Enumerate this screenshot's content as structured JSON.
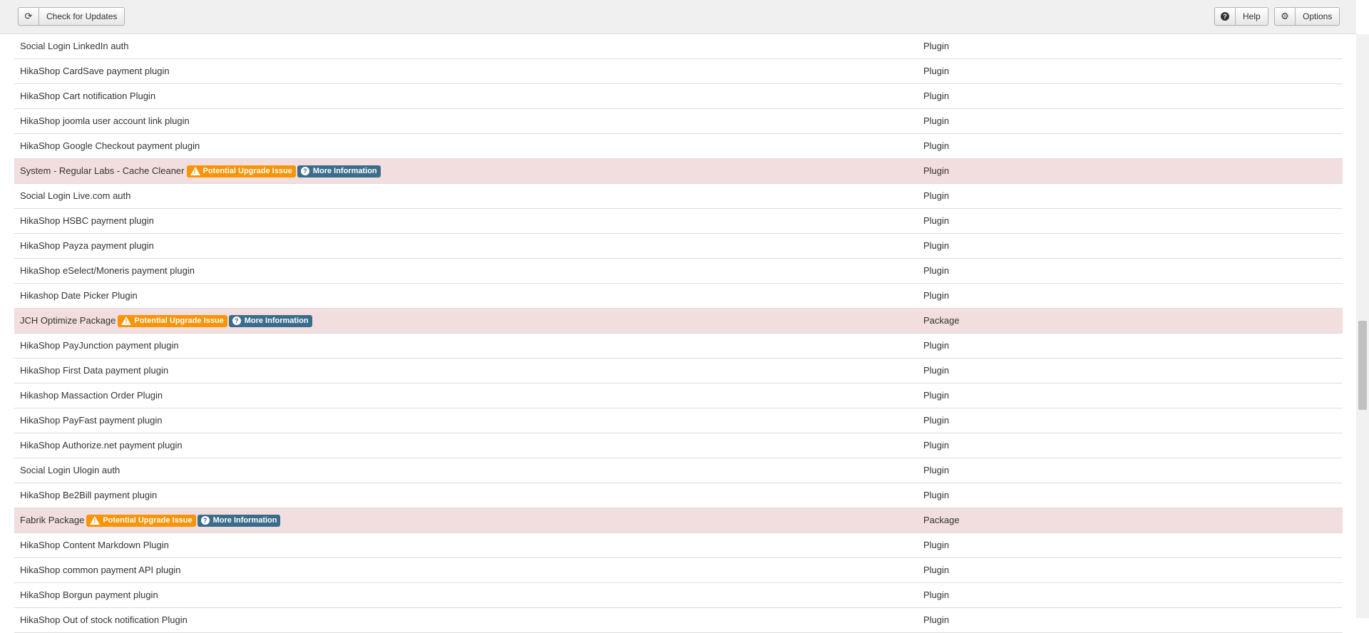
{
  "toolbar": {
    "check_updates_label": "Check for Updates",
    "help_label": "Help",
    "options_label": "Options"
  },
  "warning_badge_label": "Potential Upgrade Issue",
  "info_badge_label": "More Information",
  "colors": {
    "warning_badge": "#f89406",
    "info_badge": "#3a6d8c",
    "warning_row": "#f2dede"
  },
  "rows": [
    {
      "name": "Social Login LinkedIn auth",
      "type": "Plugin",
      "warn": false
    },
    {
      "name": "HikaShop CardSave payment plugin",
      "type": "Plugin",
      "warn": false
    },
    {
      "name": "HikaShop Cart notification Plugin",
      "type": "Plugin",
      "warn": false
    },
    {
      "name": "HikaShop joomla user account link plugin",
      "type": "Plugin",
      "warn": false
    },
    {
      "name": "HikaShop Google Checkout payment plugin",
      "type": "Plugin",
      "warn": false
    },
    {
      "name": "System - Regular Labs - Cache Cleaner",
      "type": "Plugin",
      "warn": true
    },
    {
      "name": "Social Login Live.com auth",
      "type": "Plugin",
      "warn": false
    },
    {
      "name": "HikaShop HSBC payment plugin",
      "type": "Plugin",
      "warn": false
    },
    {
      "name": "HikaShop Payza payment plugin",
      "type": "Plugin",
      "warn": false
    },
    {
      "name": "HikaShop eSelect/Moneris payment plugin",
      "type": "Plugin",
      "warn": false
    },
    {
      "name": "Hikashop Date Picker Plugin",
      "type": "Plugin",
      "warn": false
    },
    {
      "name": "JCH Optimize Package",
      "type": "Package",
      "warn": true
    },
    {
      "name": "HikaShop PayJunction payment plugin",
      "type": "Plugin",
      "warn": false
    },
    {
      "name": "HikaShop First Data payment plugin",
      "type": "Plugin",
      "warn": false
    },
    {
      "name": "Hikashop Massaction Order Plugin",
      "type": "Plugin",
      "warn": false
    },
    {
      "name": "HikaShop PayFast payment plugin",
      "type": "Plugin",
      "warn": false
    },
    {
      "name": "HikaShop Authorize.net payment plugin",
      "type": "Plugin",
      "warn": false
    },
    {
      "name": "Social Login Ulogin auth",
      "type": "Plugin",
      "warn": false
    },
    {
      "name": "HikaShop Be2Bill payment plugin",
      "type": "Plugin",
      "warn": false
    },
    {
      "name": "Fabrik Package",
      "type": "Package",
      "warn": true
    },
    {
      "name": "HikaShop Content Markdown Plugin",
      "type": "Plugin",
      "warn": false
    },
    {
      "name": "HikaShop common payment API plugin",
      "type": "Plugin",
      "warn": false
    },
    {
      "name": "HikaShop Borgun payment plugin",
      "type": "Plugin",
      "warn": false
    },
    {
      "name": "HikaShop Out of stock notification Plugin",
      "type": "Plugin",
      "warn": false
    }
  ]
}
